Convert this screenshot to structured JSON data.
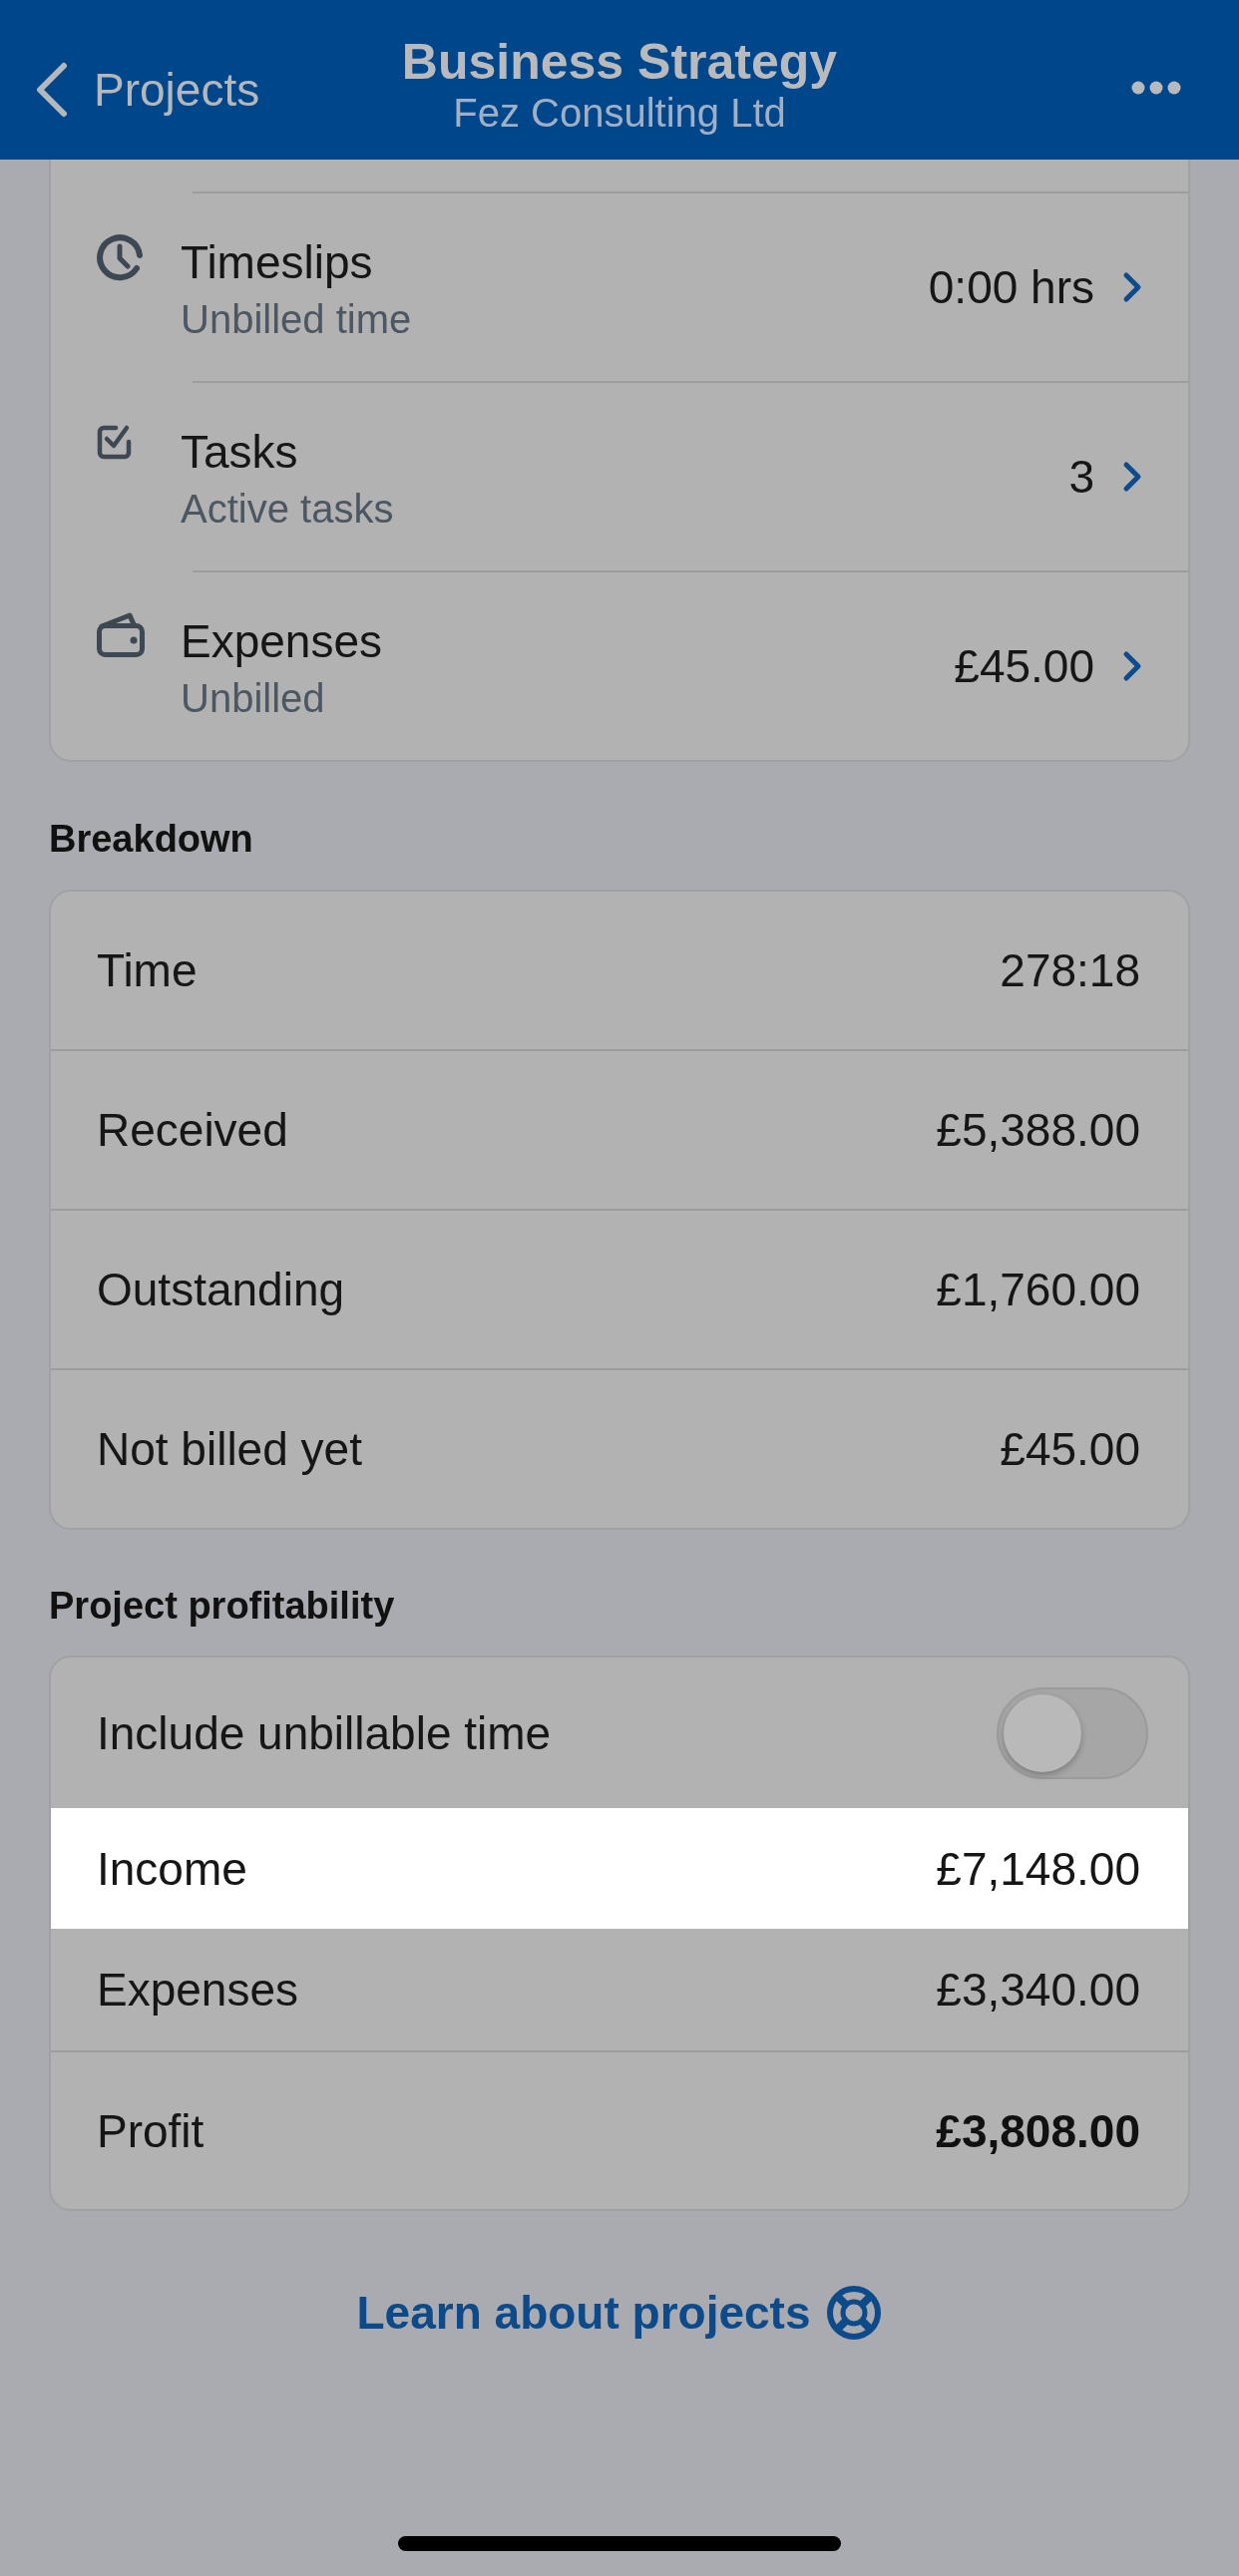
{
  "nav_bar": {
    "back_label": "Projects",
    "title": "Business Strategy",
    "subtitle": "Fez Consulting Ltd"
  },
  "summary_rows": [
    {
      "kind": "time",
      "title": "Timeslips",
      "subtitle": "Unbilled time",
      "value": "0:00 hrs"
    },
    {
      "kind": "tasks",
      "title": "Tasks",
      "subtitle": "Active tasks",
      "value": "3"
    },
    {
      "kind": "expenses",
      "title": "Expenses",
      "subtitle": "Unbilled",
      "value": "£45.00"
    }
  ],
  "breakdown": {
    "heading": "Breakdown",
    "rows": [
      {
        "label": "Time",
        "value": "278:18"
      },
      {
        "label": "Received",
        "value": "£5,388.00"
      },
      {
        "label": "Outstanding",
        "value": "£1,760.00"
      },
      {
        "label": "Not billed yet",
        "value": "£45.00"
      }
    ]
  },
  "profitability": {
    "heading": "Project profitability",
    "toggle": {
      "label": "Include unbillable time",
      "on": false
    },
    "rows": [
      {
        "kind": "line",
        "label": "Income",
        "value": "£7,148.00",
        "highlighted": true
      },
      {
        "kind": "line",
        "label": "Expenses",
        "value": "£3,340.00",
        "highlighted": false
      },
      {
        "kind": "total",
        "label": "Profit",
        "value": "£3,808.00",
        "highlighted": false
      }
    ]
  },
  "learn_link": {
    "label": "Learn about projects"
  }
}
